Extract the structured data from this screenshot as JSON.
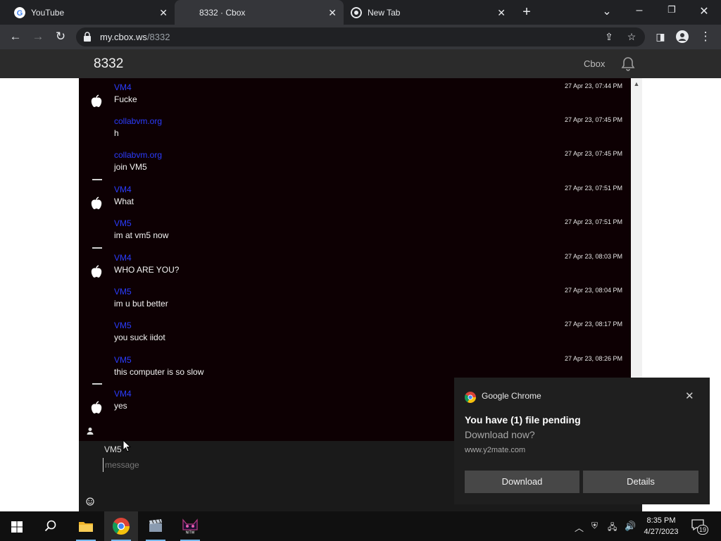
{
  "browser": {
    "tabs": [
      {
        "title": "YouTube",
        "active": false
      },
      {
        "title": "8332 · Cbox",
        "active": true
      },
      {
        "title": "New Tab",
        "active": false
      }
    ],
    "url_host": "my.cbox.ws",
    "url_path": "/8332"
  },
  "site": {
    "title": "8332",
    "brand": "Cbox"
  },
  "messages": [
    {
      "user": "VM4",
      "text": "Fucke",
      "time": "27 Apr 23, 07:44 PM",
      "avatar": true
    },
    {
      "user": "collabvm.org",
      "text": "h",
      "time": "27 Apr 23, 07:45 PM",
      "avatar": false
    },
    {
      "user": "collabvm.org",
      "text": "join VM5",
      "time": "27 Apr 23, 07:45 PM",
      "avatar": false
    },
    {
      "user": "VM4",
      "text": "What",
      "time": "27 Apr 23, 07:51 PM",
      "avatar": true
    },
    {
      "user": "VM5",
      "text": "im at vm5 now",
      "time": "27 Apr 23, 07:51 PM",
      "avatar": false
    },
    {
      "user": "VM4",
      "text": "WHO ARE YOU?",
      "time": "27 Apr 23, 08:03 PM",
      "avatar": true
    },
    {
      "user": "VM5",
      "text": "im u but better",
      "time": "27 Apr 23, 08:04 PM",
      "avatar": false
    },
    {
      "user": "VM5",
      "text": "you suck iidot",
      "time": "27 Apr 23, 08:17 PM",
      "avatar": false
    },
    {
      "user": "VM5",
      "text": "this computer is so slow",
      "time": "27 Apr 23, 08:26 PM",
      "avatar": false
    },
    {
      "user": "VM4",
      "text": "yes",
      "time": "",
      "avatar": true
    }
  ],
  "compose": {
    "username": "VM5",
    "placeholder": "message"
  },
  "notification": {
    "app": "Google Chrome",
    "title": "You have (1) file pending",
    "subtitle": "Download now?",
    "site": "www.y2mate.com",
    "download_label": "Download",
    "details_label": "Details"
  },
  "taskbar": {
    "time": "8:35 PM",
    "date": "4/27/2023",
    "notification_count": "19"
  },
  "colors": {
    "chat_bg": "#0d0003",
    "username": "#2b3cff"
  }
}
